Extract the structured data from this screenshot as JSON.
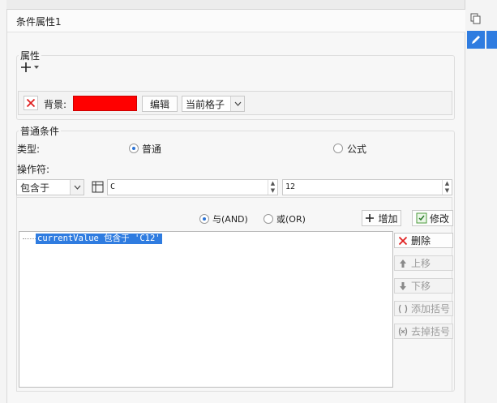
{
  "dialog": {
    "title": "条件属性1"
  },
  "attributes": {
    "legend": "属性",
    "background_label": "背景:",
    "background_color": "#ff0000",
    "edit_button": "编辑",
    "scope_select": "当前格子"
  },
  "condition": {
    "legend": "普通条件",
    "type_label": "类型:",
    "type_normal": "普通",
    "type_formula": "公式",
    "operator_label": "操作符:",
    "operator_select": "包含于",
    "value1": "C",
    "value2": "12",
    "logic_and": "与(AND)",
    "logic_or": "或(OR)",
    "add_button": "增加",
    "modify_button": "修改"
  },
  "list": {
    "items": [
      "currentValue 包含于 'C12'"
    ]
  },
  "actions": {
    "delete": "删除",
    "move_up": "上移",
    "move_down": "下移",
    "add_bracket": "添加括号",
    "remove_bracket": "去掉括号"
  }
}
